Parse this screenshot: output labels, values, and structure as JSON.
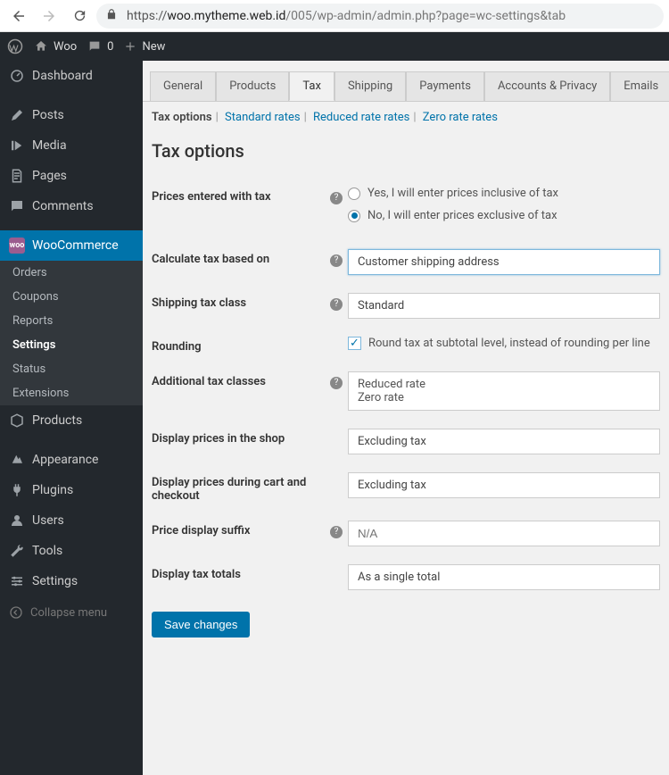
{
  "browser": {
    "url_host": "woo.mytheme.web.id",
    "url_path": "/005/wp-admin/admin.php?page=wc-settings&tab"
  },
  "adminbar": {
    "site": "Woo",
    "comments": "0",
    "new": "New"
  },
  "sidebar": {
    "items": [
      {
        "label": "Dashboard"
      },
      {
        "label": "Posts"
      },
      {
        "label": "Media"
      },
      {
        "label": "Pages"
      },
      {
        "label": "Comments"
      },
      {
        "label": "WooCommerce"
      },
      {
        "label": "Products"
      },
      {
        "label": "Appearance"
      },
      {
        "label": "Plugins"
      },
      {
        "label": "Users"
      },
      {
        "label": "Tools"
      },
      {
        "label": "Settings"
      }
    ],
    "submenu": [
      {
        "label": "Orders"
      },
      {
        "label": "Coupons"
      },
      {
        "label": "Reports"
      },
      {
        "label": "Settings"
      },
      {
        "label": "Status"
      },
      {
        "label": "Extensions"
      }
    ],
    "collapse": "Collapse menu"
  },
  "tabs": [
    "General",
    "Products",
    "Tax",
    "Shipping",
    "Payments",
    "Accounts & Privacy",
    "Emails"
  ],
  "subtabs": [
    "Tax options",
    "Standard rates",
    "Reduced rate rates",
    "Zero rate rates"
  ],
  "section_title": "Tax options",
  "fields": {
    "prices_entered": {
      "label": "Prices entered with tax",
      "opt1": "Yes, I will enter prices inclusive of tax",
      "opt2": "No, I will enter prices exclusive of tax"
    },
    "calc_based": {
      "label": "Calculate tax based on",
      "value": "Customer shipping address"
    },
    "ship_class": {
      "label": "Shipping tax class",
      "value": "Standard"
    },
    "rounding": {
      "label": "Rounding",
      "text": "Round tax at subtotal level, instead of rounding per line"
    },
    "addl_classes": {
      "label": "Additional tax classes",
      "value": "Reduced rate\nZero rate"
    },
    "display_shop": {
      "label": "Display prices in the shop",
      "value": "Excluding tax"
    },
    "display_cart": {
      "label": "Display prices during cart and checkout",
      "value": "Excluding tax"
    },
    "price_suffix": {
      "label": "Price display suffix",
      "placeholder": "N/A"
    },
    "display_totals": {
      "label": "Display tax totals",
      "value": "As a single total"
    }
  },
  "save": "Save changes"
}
